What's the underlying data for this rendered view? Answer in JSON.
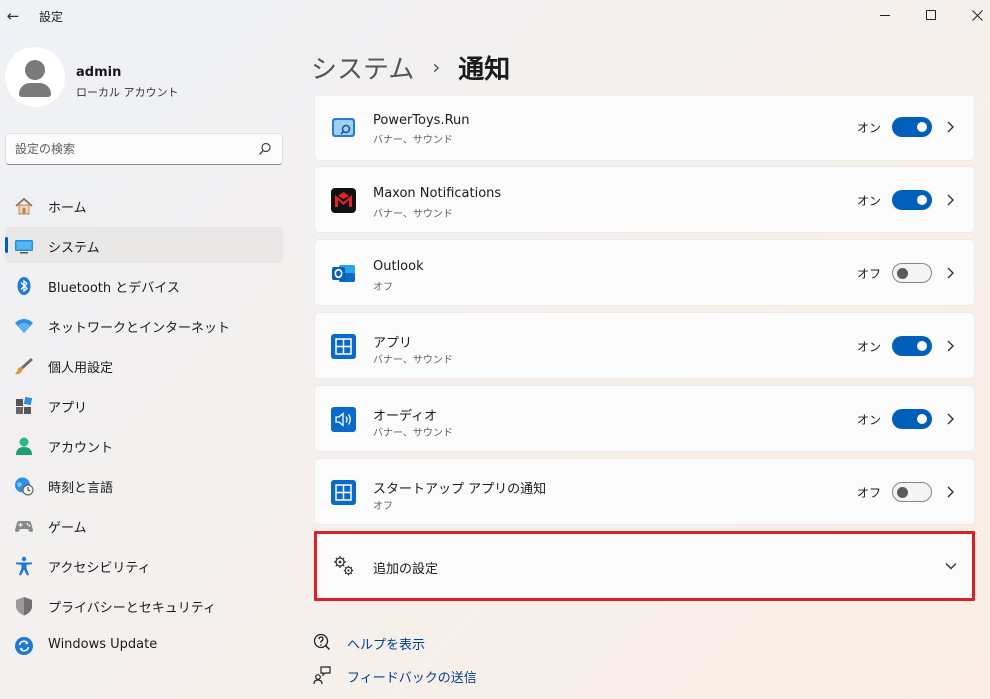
{
  "window": {
    "title": "設定",
    "back_glyph": "←"
  },
  "user": {
    "name": "admin",
    "account_type": "ローカル アカウント"
  },
  "search": {
    "placeholder": "設定の検索"
  },
  "sidebar": {
    "items": [
      {
        "label": "ホーム",
        "icon": "home-icon"
      },
      {
        "label": "システム",
        "icon": "system-icon",
        "active": true
      },
      {
        "label": "Bluetooth とデバイス",
        "icon": "bluetooth-icon"
      },
      {
        "label": "ネットワークとインターネット",
        "icon": "wifi-icon"
      },
      {
        "label": "個人用設定",
        "icon": "brush-icon"
      },
      {
        "label": "アプリ",
        "icon": "apps-icon"
      },
      {
        "label": "アカウント",
        "icon": "account-icon"
      },
      {
        "label": "時刻と言語",
        "icon": "globe-clock-icon"
      },
      {
        "label": "ゲーム",
        "icon": "gamepad-icon"
      },
      {
        "label": "アクセシビリティ",
        "icon": "accessibility-icon"
      },
      {
        "label": "プライバシーとセキュリティ",
        "icon": "shield-icon"
      },
      {
        "label": "Windows Update",
        "icon": "update-icon"
      }
    ]
  },
  "breadcrumb": {
    "parent": "システム",
    "separator": "›",
    "current": "通知"
  },
  "apps": [
    {
      "name": "PowerToys.Run",
      "sub": "バナー、サウンド",
      "state": "オン",
      "enabled": true,
      "icon": "powertoys-run-icon"
    },
    {
      "name": "Maxon Notifications",
      "sub": "バナー、サウンド",
      "state": "オン",
      "enabled": true,
      "icon": "maxon-icon"
    },
    {
      "name": "Outlook",
      "sub": "オフ",
      "state": "オフ",
      "enabled": false,
      "icon": "outlook-icon"
    },
    {
      "name": "アプリ",
      "sub": "バナー、サウンド",
      "state": "オン",
      "enabled": true,
      "icon": "app-tile-icon"
    },
    {
      "name": "オーディオ",
      "sub": "バナー、サウンド",
      "state": "オン",
      "enabled": true,
      "icon": "audio-icon"
    },
    {
      "name": "スタートアップ アプリの通知",
      "sub": "オフ",
      "state": "オフ",
      "enabled": false,
      "icon": "app-tile-icon"
    }
  ],
  "additional_settings": {
    "label": "追加の設定",
    "icon": "gears-icon"
  },
  "links": {
    "help": "ヘルプを表示",
    "feedback": "フィードバックの送信"
  },
  "colors": {
    "accent": "#005fb8",
    "highlight_border": "#e01e26",
    "link": "#003e92"
  }
}
